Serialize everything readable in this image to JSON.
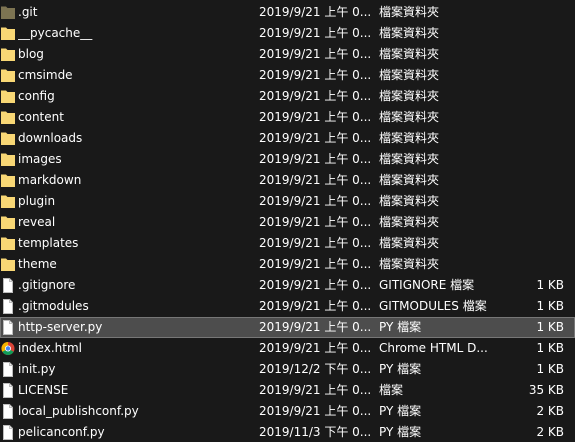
{
  "files": [
    {
      "name": ".git",
      "date": "2019/9/21 上午 0...",
      "type": "檔案資料夾",
      "size": "",
      "icon": "folder-icon-dark"
    },
    {
      "name": "__pycache__",
      "date": "2019/9/21 上午 0...",
      "type": "檔案資料夾",
      "size": "",
      "icon": "folder-icon"
    },
    {
      "name": "blog",
      "date": "2019/9/21 上午 0...",
      "type": "檔案資料夾",
      "size": "",
      "icon": "folder-icon"
    },
    {
      "name": "cmsimde",
      "date": "2019/9/21 上午 0...",
      "type": "檔案資料夾",
      "size": "",
      "icon": "folder-icon"
    },
    {
      "name": "config",
      "date": "2019/9/21 上午 0...",
      "type": "檔案資料夾",
      "size": "",
      "icon": "folder-icon"
    },
    {
      "name": "content",
      "date": "2019/9/21 上午 0...",
      "type": "檔案資料夾",
      "size": "",
      "icon": "folder-icon"
    },
    {
      "name": "downloads",
      "date": "2019/9/21 上午 0...",
      "type": "檔案資料夾",
      "size": "",
      "icon": "folder-icon"
    },
    {
      "name": "images",
      "date": "2019/9/21 上午 0...",
      "type": "檔案資料夾",
      "size": "",
      "icon": "folder-icon"
    },
    {
      "name": "markdown",
      "date": "2019/9/21 上午 0...",
      "type": "檔案資料夾",
      "size": "",
      "icon": "folder-icon"
    },
    {
      "name": "plugin",
      "date": "2019/9/21 上午 0...",
      "type": "檔案資料夾",
      "size": "",
      "icon": "folder-icon"
    },
    {
      "name": "reveal",
      "date": "2019/9/21 上午 0...",
      "type": "檔案資料夾",
      "size": "",
      "icon": "folder-icon"
    },
    {
      "name": "templates",
      "date": "2019/9/21 上午 0...",
      "type": "檔案資料夾",
      "size": "",
      "icon": "folder-icon"
    },
    {
      "name": "theme",
      "date": "2019/9/21 上午 0...",
      "type": "檔案資料夾",
      "size": "",
      "icon": "folder-icon"
    },
    {
      "name": ".gitignore",
      "date": "2019/9/21 上午 0...",
      "type": "GITIGNORE 檔案",
      "size": "1 KB",
      "icon": "file-icon"
    },
    {
      "name": ".gitmodules",
      "date": "2019/9/21 上午 0...",
      "type": "GITMODULES 檔案",
      "size": "1 KB",
      "icon": "file-icon"
    },
    {
      "name": "http-server.py",
      "date": "2019/9/21 上午 0...",
      "type": "PY 檔案",
      "size": "1 KB",
      "icon": "file-icon",
      "selected": true
    },
    {
      "name": "index.html",
      "date": "2019/9/21 上午 0...",
      "type": "Chrome HTML D...",
      "size": "1 KB",
      "icon": "chrome-icon"
    },
    {
      "name": "init.py",
      "date": "2019/12/2 下午 0...",
      "type": "PY 檔案",
      "size": "1 KB",
      "icon": "file-icon"
    },
    {
      "name": "LICENSE",
      "date": "2019/9/21 上午 0...",
      "type": "檔案",
      "size": "35 KB",
      "icon": "file-icon"
    },
    {
      "name": "local_publishconf.py",
      "date": "2019/9/21 上午 0...",
      "type": "PY 檔案",
      "size": "2 KB",
      "icon": "file-icon"
    },
    {
      "name": "pelicanconf.py",
      "date": "2019/11/3 下午 0...",
      "type": "PY 檔案",
      "size": "2 KB",
      "icon": "file-icon"
    }
  ],
  "colors": {
    "background": "#191919",
    "text": "#ffffff",
    "selected_bg": "#4d4d4d",
    "folder": "#f8d775",
    "folder_dark": "#7d7452"
  }
}
